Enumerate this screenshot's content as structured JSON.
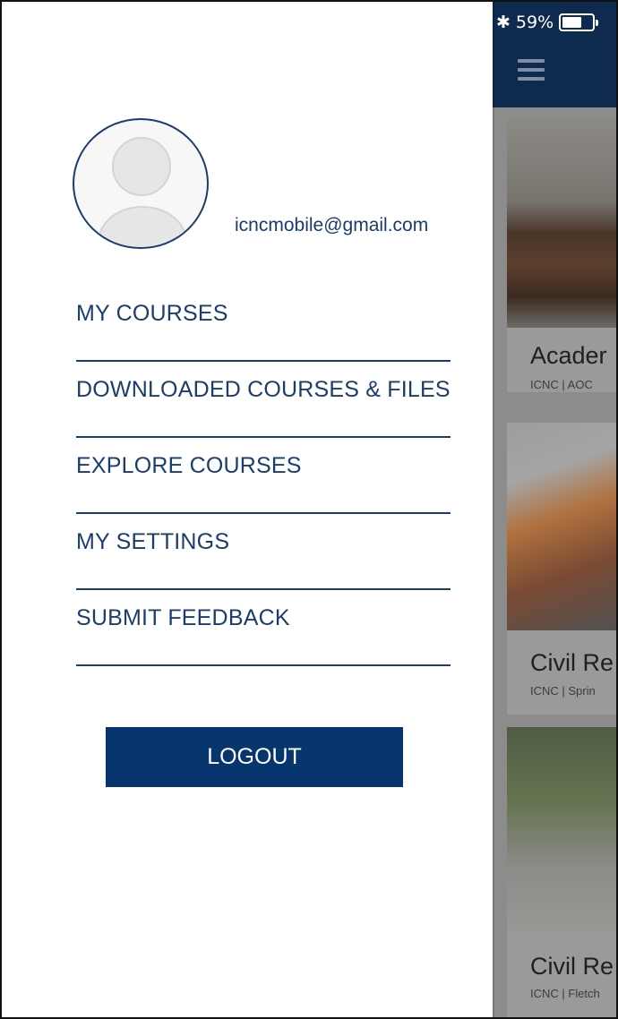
{
  "status_bar": {
    "bluetooth_icon": "bluetooth-icon",
    "battery_percent": "59%",
    "battery_level": 0.59
  },
  "header": {
    "menu_icon": "hamburger-menu-icon"
  },
  "background_cards": [
    {
      "title": "Acader",
      "subtitle": "ICNC | AOC"
    },
    {
      "title": "Civil Re",
      "subtitle": "ICNC | Sprin"
    },
    {
      "title": "Civil Re",
      "subtitle": "ICNC | Fletch"
    }
  ],
  "drawer": {
    "avatar_icon": "user-avatar-icon",
    "email": "icncmobile@gmail.com",
    "menu": [
      {
        "label": "MY COURSES"
      },
      {
        "label": "DOWNLOADED COURSES & FILES"
      },
      {
        "label": "EXPLORE COURSES"
      },
      {
        "label": "MY SETTINGS"
      },
      {
        "label": "SUBMIT FEEDBACK"
      }
    ],
    "logout_label": "LOGOUT"
  },
  "colors": {
    "brand_navy": "#1b3d6d",
    "button_blue": "#07366f",
    "app_bar": "#0f2a4f"
  }
}
